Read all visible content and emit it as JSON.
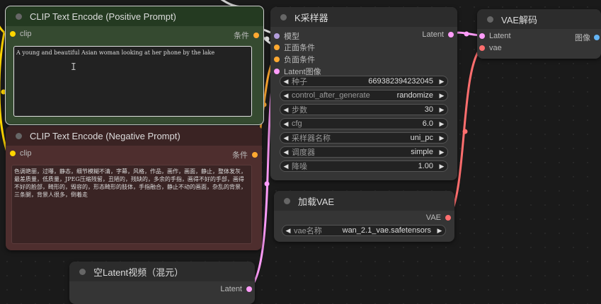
{
  "colors": {
    "clip": "#ffd500",
    "conditioning": "#ffa931",
    "model": "#b39ddb",
    "latent": "#ff9cf9",
    "vae": "#ff6e6e",
    "image": "#64b5f6"
  },
  "positive": {
    "title": "CLIP Text Encode (Positive Prompt)",
    "input_clip": "clip",
    "output": "条件",
    "text": "A young and beautiful Asian woman looking at her phone by the lake"
  },
  "negative": {
    "title": "CLIP Text Encode (Negative Prompt)",
    "input_clip": "clip",
    "output": "条件",
    "text": "色调艳丽，过曝，静态，细节模糊不清，字幕，风格，作品，画作，画面，静止，整体发灰，最差质量，低质量，JPEG压缩残留，丑陋的，残缺的，多余的手指，画得不好的手部，画得不好的脸部，畸形的，毁容的，形态畸形的肢体，手指融合，静止不动的画面，杂乱的背景，三条腿，背景人很多，倒着走"
  },
  "ksampler": {
    "title": "K采样器",
    "inputs": [
      "模型",
      "正面条件",
      "负面条件",
      "Latent图像"
    ],
    "output": "Latent",
    "widgets": [
      {
        "label": "种子",
        "value": "669382394232045"
      },
      {
        "label": "control_after_generate",
        "value": "randomize"
      },
      {
        "label": "步数",
        "value": "30"
      },
      {
        "label": "cfg",
        "value": "6.0"
      },
      {
        "label": "采样器名称",
        "value": "uni_pc"
      },
      {
        "label": "调度器",
        "value": "simple"
      },
      {
        "label": "降噪",
        "value": "1.00"
      }
    ]
  },
  "vae_decode": {
    "title": "VAE解码",
    "input_latent": "Latent",
    "input_vae": "vae",
    "output": "图像"
  },
  "load_vae": {
    "title": "加载VAE",
    "output": "VAE",
    "widget_label": "vae名称",
    "widget_value": "wan_2.1_vae.safetensors"
  },
  "empty_latent": {
    "title": "空Latent视频（混元）",
    "output": "Latent"
  }
}
